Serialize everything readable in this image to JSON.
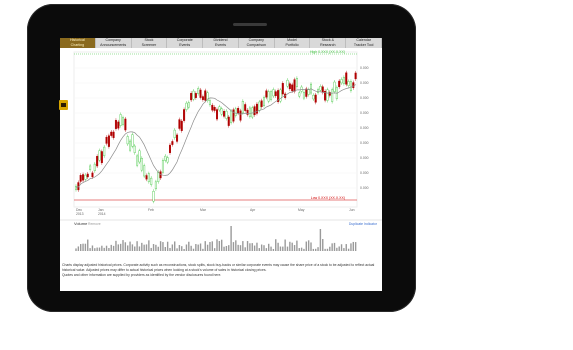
{
  "tabs": [
    {
      "line1": "Historical",
      "line2": "Charting",
      "active": true
    },
    {
      "line1": "Company",
      "line2": "Announcements"
    },
    {
      "line1": "Stock",
      "line2": "Screener"
    },
    {
      "line1": "Corporate",
      "line2": "Events"
    },
    {
      "line1": "Dividend",
      "line2": "Events"
    },
    {
      "line1": "Company",
      "line2": "Comparison"
    },
    {
      "line1": "Model",
      "line2": "Portfolio"
    },
    {
      "line1": "Stock &",
      "line2": "Research"
    },
    {
      "line1": "Calendar",
      "line2": "Tracker Tool"
    }
  ],
  "chart": {
    "high_label": "High 0.XXX (XX.X.XX)",
    "low_label": "Low 0.XXX (XX.X.XX)",
    "y_ticks": [
      "0.000",
      "0.000",
      "0.000",
      "0.000",
      "0.000",
      "0.000",
      "0.000",
      "0.000",
      "0.000"
    ],
    "x_ticks": [
      "Dec\n2013",
      "Jan\n2014",
      "Feb",
      "Mar",
      "Apr",
      "May",
      "Jun"
    ],
    "volume_title": "Volume",
    "volume_sub": "Remove",
    "volume_link": "Duplicate Indicator"
  },
  "chart_data": {
    "type": "candlestick",
    "ma": "grey moving average line",
    "colors": {
      "up": "#3cc43c",
      "down": "#b00000",
      "ma": "#8c8c8c",
      "volume": "#999999"
    }
  },
  "footer": {
    "line1": "Charts display adjusted historical prices. Corporate activity such as reconstructions, stock splits, stock buy-backs or similar corporate events may cause the share price of a stock to be adjusted to reflect actual historical value. Adjusted prices may differ to actual historical prices when looking at a stock's volume of sales in historical closing prices.",
    "line2": "Quotes and other information are supplied by providers as identified by the vendor disclosures found here."
  }
}
